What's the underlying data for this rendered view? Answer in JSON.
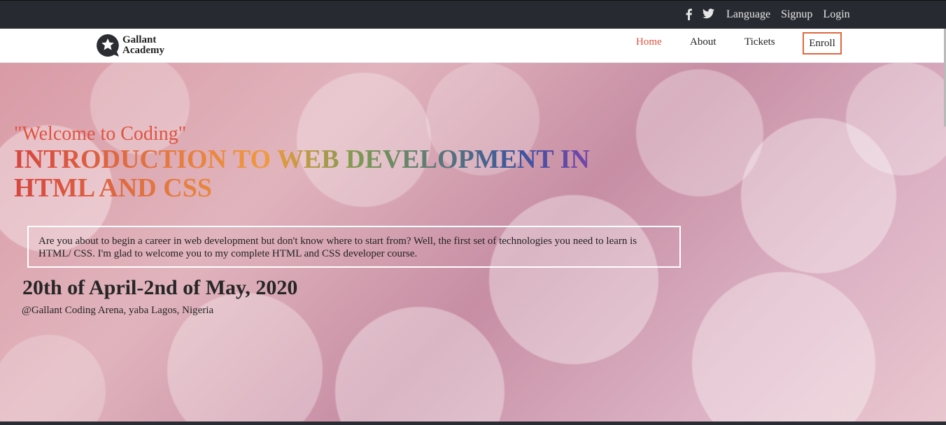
{
  "topbar": {
    "social_icons": [
      "facebook-icon",
      "twitter-icon"
    ],
    "links": [
      "Language",
      "Signup",
      "Login"
    ]
  },
  "navbar": {
    "logo_line1": "Gallant",
    "logo_line2": "Academy",
    "items": {
      "home": "Home",
      "about": "About",
      "tickets": "Tickets",
      "enroll": "Enroll"
    }
  },
  "hero": {
    "welcome": "\"Welcome to Coding\"",
    "title": "INTRODUCTION TO WEB DEVELOPMENT IN HTML AND CSS",
    "intro": "Are you about to begin a career in web development but don't know where to start from? Well, the first set of technologies you need to learn is HTML/ CSS. I'm glad to welcome you to my complete HTML and CSS developer course.",
    "date": "20th of April-2nd of May, 2020",
    "venue": "@Gallant Coding Arena, yaba Lagos, Nigeria"
  },
  "colors": {
    "accent": "#e0533f",
    "enroll_border": "#e0673f",
    "topbar_bg": "#272a30"
  }
}
